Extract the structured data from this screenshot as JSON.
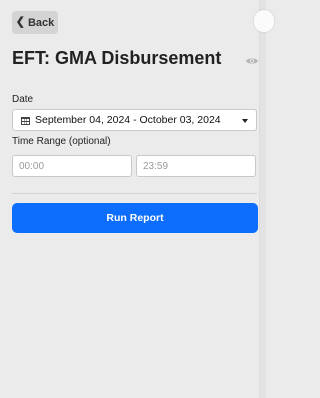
{
  "header": {
    "back_label": "Back",
    "title": "EFT: GMA Disbursement"
  },
  "icons": {
    "back": "chevron-left-icon",
    "visibility": "eye-icon",
    "calendar": "calendar-icon",
    "dropdown": "caret-down-icon"
  },
  "form": {
    "date_label": "Date",
    "date_value": "September 04, 2024 - October 03, 2024",
    "time_range_label": "Time Range (optional)",
    "start_time_placeholder": "00:00",
    "end_time_placeholder": "23:59"
  },
  "actions": {
    "run_report_label": "Run Report"
  },
  "colors": {
    "background": "#ebebeb",
    "primary": "#0d6efd",
    "back_button": "#d4d4d4"
  }
}
